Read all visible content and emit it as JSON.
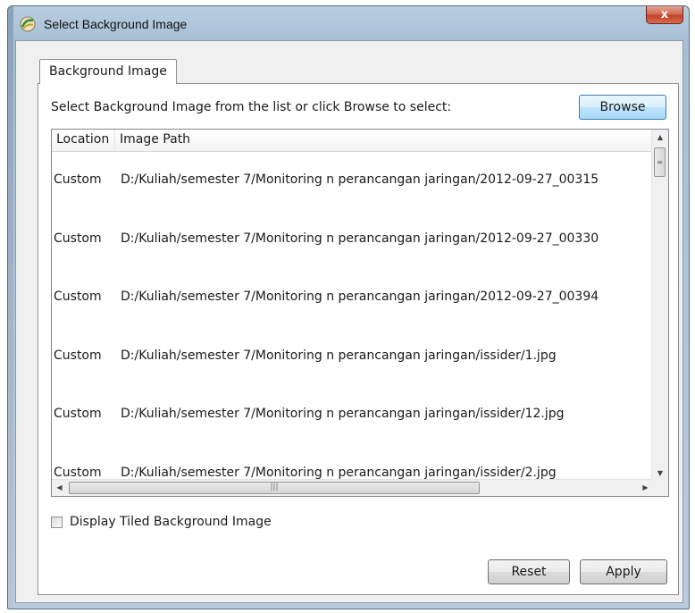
{
  "window": {
    "title": "Select Background Image",
    "close_label": "x"
  },
  "tabs": [
    {
      "label": "Background Image",
      "selected": true
    }
  ],
  "instruction": "Select Background Image from the list or click Browse to select:",
  "buttons": {
    "browse": "Browse",
    "reset": "Reset",
    "apply": "Apply"
  },
  "list": {
    "columns": [
      "Location",
      "Image Path"
    ],
    "rows": [
      {
        "location": "Custom",
        "path": "D:/Kuliah/semester 7/Monitoring n perancangan jaringan/2012-09-27_00315"
      },
      {
        "location": "Custom",
        "path": "D:/Kuliah/semester 7/Monitoring n perancangan jaringan/2012-09-27_00330"
      },
      {
        "location": "Custom",
        "path": "D:/Kuliah/semester 7/Monitoring n perancangan jaringan/2012-09-27_00394"
      },
      {
        "location": "Custom",
        "path": "D:/Kuliah/semester 7/Monitoring n perancangan jaringan/issider/1.jpg"
      },
      {
        "location": "Custom",
        "path": "D:/Kuliah/semester 7/Monitoring n perancangan jaringan/issider/12.jpg"
      },
      {
        "location": "Custom",
        "path": "D:/Kuliah/semester 7/Monitoring n perancangan jaringan/issider/2.jpg"
      }
    ]
  },
  "checkbox": {
    "label": "Display Tiled Background Image",
    "checked": false
  },
  "icons": {
    "app": "app-icon",
    "close": "close-icon",
    "scroll_up": "arrow-up-icon",
    "scroll_down": "arrow-down-icon",
    "scroll_left": "arrow-left-icon",
    "scroll_right": "arrow-right-icon"
  },
  "colors": {
    "close_button": "#c2432b",
    "browse_border": "#3c7fb1"
  }
}
